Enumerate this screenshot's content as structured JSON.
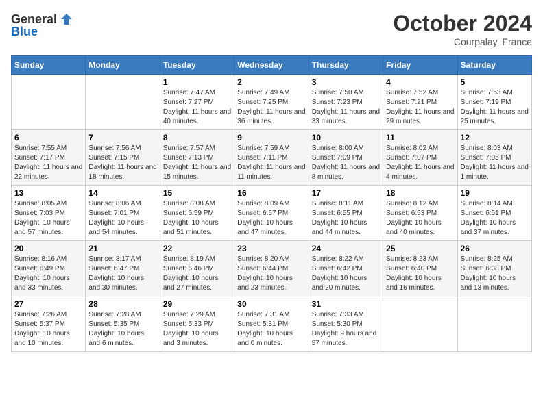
{
  "header": {
    "logo": {
      "general": "General",
      "blue": "Blue"
    },
    "month": "October 2024",
    "location": "Courpalay, France"
  },
  "days_of_week": [
    "Sunday",
    "Monday",
    "Tuesday",
    "Wednesday",
    "Thursday",
    "Friday",
    "Saturday"
  ],
  "weeks": [
    [
      {
        "day": "",
        "info": ""
      },
      {
        "day": "",
        "info": ""
      },
      {
        "day": "1",
        "info": "Sunrise: 7:47 AM\nSunset: 7:27 PM\nDaylight: 11 hours and 40 minutes."
      },
      {
        "day": "2",
        "info": "Sunrise: 7:49 AM\nSunset: 7:25 PM\nDaylight: 11 hours and 36 minutes."
      },
      {
        "day": "3",
        "info": "Sunrise: 7:50 AM\nSunset: 7:23 PM\nDaylight: 11 hours and 33 minutes."
      },
      {
        "day": "4",
        "info": "Sunrise: 7:52 AM\nSunset: 7:21 PM\nDaylight: 11 hours and 29 minutes."
      },
      {
        "day": "5",
        "info": "Sunrise: 7:53 AM\nSunset: 7:19 PM\nDaylight: 11 hours and 25 minutes."
      }
    ],
    [
      {
        "day": "6",
        "info": "Sunrise: 7:55 AM\nSunset: 7:17 PM\nDaylight: 11 hours and 22 minutes."
      },
      {
        "day": "7",
        "info": "Sunrise: 7:56 AM\nSunset: 7:15 PM\nDaylight: 11 hours and 18 minutes."
      },
      {
        "day": "8",
        "info": "Sunrise: 7:57 AM\nSunset: 7:13 PM\nDaylight: 11 hours and 15 minutes."
      },
      {
        "day": "9",
        "info": "Sunrise: 7:59 AM\nSunset: 7:11 PM\nDaylight: 11 hours and 11 minutes."
      },
      {
        "day": "10",
        "info": "Sunrise: 8:00 AM\nSunset: 7:09 PM\nDaylight: 11 hours and 8 minutes."
      },
      {
        "day": "11",
        "info": "Sunrise: 8:02 AM\nSunset: 7:07 PM\nDaylight: 11 hours and 4 minutes."
      },
      {
        "day": "12",
        "info": "Sunrise: 8:03 AM\nSunset: 7:05 PM\nDaylight: 11 hours and 1 minute."
      }
    ],
    [
      {
        "day": "13",
        "info": "Sunrise: 8:05 AM\nSunset: 7:03 PM\nDaylight: 10 hours and 57 minutes."
      },
      {
        "day": "14",
        "info": "Sunrise: 8:06 AM\nSunset: 7:01 PM\nDaylight: 10 hours and 54 minutes."
      },
      {
        "day": "15",
        "info": "Sunrise: 8:08 AM\nSunset: 6:59 PM\nDaylight: 10 hours and 51 minutes."
      },
      {
        "day": "16",
        "info": "Sunrise: 8:09 AM\nSunset: 6:57 PM\nDaylight: 10 hours and 47 minutes."
      },
      {
        "day": "17",
        "info": "Sunrise: 8:11 AM\nSunset: 6:55 PM\nDaylight: 10 hours and 44 minutes."
      },
      {
        "day": "18",
        "info": "Sunrise: 8:12 AM\nSunset: 6:53 PM\nDaylight: 10 hours and 40 minutes."
      },
      {
        "day": "19",
        "info": "Sunrise: 8:14 AM\nSunset: 6:51 PM\nDaylight: 10 hours and 37 minutes."
      }
    ],
    [
      {
        "day": "20",
        "info": "Sunrise: 8:16 AM\nSunset: 6:49 PM\nDaylight: 10 hours and 33 minutes."
      },
      {
        "day": "21",
        "info": "Sunrise: 8:17 AM\nSunset: 6:47 PM\nDaylight: 10 hours and 30 minutes."
      },
      {
        "day": "22",
        "info": "Sunrise: 8:19 AM\nSunset: 6:46 PM\nDaylight: 10 hours and 27 minutes."
      },
      {
        "day": "23",
        "info": "Sunrise: 8:20 AM\nSunset: 6:44 PM\nDaylight: 10 hours and 23 minutes."
      },
      {
        "day": "24",
        "info": "Sunrise: 8:22 AM\nSunset: 6:42 PM\nDaylight: 10 hours and 20 minutes."
      },
      {
        "day": "25",
        "info": "Sunrise: 8:23 AM\nSunset: 6:40 PM\nDaylight: 10 hours and 16 minutes."
      },
      {
        "day": "26",
        "info": "Sunrise: 8:25 AM\nSunset: 6:38 PM\nDaylight: 10 hours and 13 minutes."
      }
    ],
    [
      {
        "day": "27",
        "info": "Sunrise: 7:26 AM\nSunset: 5:37 PM\nDaylight: 10 hours and 10 minutes."
      },
      {
        "day": "28",
        "info": "Sunrise: 7:28 AM\nSunset: 5:35 PM\nDaylight: 10 hours and 6 minutes."
      },
      {
        "day": "29",
        "info": "Sunrise: 7:29 AM\nSunset: 5:33 PM\nDaylight: 10 hours and 3 minutes."
      },
      {
        "day": "30",
        "info": "Sunrise: 7:31 AM\nSunset: 5:31 PM\nDaylight: 10 hours and 0 minutes."
      },
      {
        "day": "31",
        "info": "Sunrise: 7:33 AM\nSunset: 5:30 PM\nDaylight: 9 hours and 57 minutes."
      },
      {
        "day": "",
        "info": ""
      },
      {
        "day": "",
        "info": ""
      }
    ]
  ]
}
